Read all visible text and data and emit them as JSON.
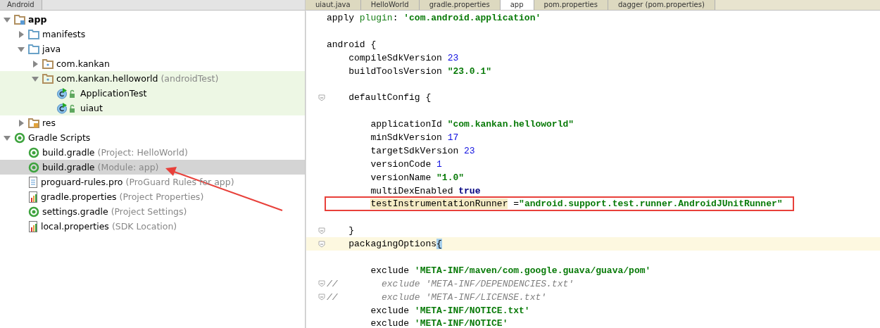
{
  "project_panel": {
    "tab": "Android",
    "tree": [
      {
        "name": "app",
        "kind": "module",
        "bold": true,
        "expanded": true,
        "selected": false,
        "children": [
          {
            "name": "manifests",
            "kind": "folder",
            "expanded": false,
            "selected": false
          },
          {
            "name": "java",
            "kind": "folder",
            "expanded": true,
            "selected": false,
            "children": [
              {
                "name": "com.kankan",
                "kind": "package",
                "expanded": false,
                "selected": false
              },
              {
                "name": "com.kankan.helloworld",
                "detail": "(androidTest)",
                "kind": "package",
                "highlighted": true,
                "expanded": true,
                "selected": false,
                "children": [
                  {
                    "name": "ApplicationTest",
                    "kind": "class",
                    "selected": false
                  },
                  {
                    "name": "uiaut",
                    "kind": "class",
                    "selected": false
                  }
                ]
              }
            ]
          },
          {
            "name": "res",
            "kind": "res",
            "expanded": false,
            "selected": false
          }
        ]
      },
      {
        "name": "Gradle Scripts",
        "kind": "gradle",
        "expanded": true,
        "selected": false,
        "children": [
          {
            "name": "build.gradle",
            "detail": "(Project: HelloWorld)",
            "kind": "gradle",
            "selected": false
          },
          {
            "name": "build.gradle",
            "detail": "(Module: app)",
            "kind": "gradle",
            "selected": true,
            "arrow": true
          },
          {
            "name": "proguard-rules.pro",
            "detail": "(ProGuard Rules for app)",
            "kind": "file",
            "selected": false
          },
          {
            "name": "gradle.properties",
            "detail": "(Project Properties)",
            "kind": "props",
            "selected": false
          },
          {
            "name": "settings.gradle",
            "detail": "(Project Settings)",
            "kind": "gradle",
            "selected": false
          },
          {
            "name": "local.properties",
            "detail": "(SDK Location)",
            "kind": "props",
            "selected": false
          }
        ]
      }
    ]
  },
  "editor_tabs": [
    {
      "label": "uiaut.java",
      "selected": false
    },
    {
      "label": "HelloWorld",
      "selected": false
    },
    {
      "label": "gradle.properties",
      "selected": false
    },
    {
      "label": "app",
      "selected": true
    },
    {
      "label": "pom.properties",
      "selected": false
    },
    {
      "label": "dagger (pom.properties)",
      "selected": false
    }
  ],
  "code": [
    {
      "tokens": [
        {
          "kind": "text",
          "t": "apply "
        },
        {
          "kind": "keyword",
          "t": "plugin"
        },
        {
          "kind": "text",
          "t": ": "
        },
        {
          "kind": "string",
          "t": "'com.android.application'"
        }
      ]
    },
    {
      "blank_before": true,
      "tokens": [
        {
          "kind": "text",
          "t": "android {"
        }
      ]
    },
    {
      "tokens": [
        {
          "kind": "text",
          "t": "    compileSdkVersion "
        },
        {
          "kind": "number",
          "t": "23"
        }
      ]
    },
    {
      "tokens": [
        {
          "kind": "text",
          "t": "    buildToolsVersion "
        },
        {
          "kind": "string",
          "t": "\"23.0.1\""
        }
      ]
    },
    {
      "blank_before": true,
      "fold": true,
      "tokens": [
        {
          "kind": "text",
          "t": "    defaultConfig {"
        }
      ]
    },
    {
      "blank_before": true,
      "tokens": [
        {
          "kind": "text",
          "t": "        applicationId "
        },
        {
          "kind": "string",
          "t": "\"com.kankan.helloworld\""
        }
      ]
    },
    {
      "tokens": [
        {
          "kind": "text",
          "t": "        minSdkVersion "
        },
        {
          "kind": "number",
          "t": "17"
        }
      ]
    },
    {
      "tokens": [
        {
          "kind": "text",
          "t": "        targetSdkVersion "
        },
        {
          "kind": "number",
          "t": "23"
        }
      ]
    },
    {
      "tokens": [
        {
          "kind": "text",
          "t": "        versionCode "
        },
        {
          "kind": "number",
          "t": "1"
        }
      ]
    },
    {
      "tokens": [
        {
          "kind": "text",
          "t": "        versionName "
        },
        {
          "kind": "string",
          "t": "\"1.0\""
        }
      ]
    },
    {
      "tokens": [
        {
          "kind": "text",
          "t": "        multiDexEnabled "
        },
        {
          "kind": "bool",
          "t": "true"
        }
      ]
    },
    {
      "boxed": true,
      "tokens": [
        {
          "kind": "ident",
          "t": "        testInstrumentationRunner"
        },
        {
          "kind": "text",
          "t": " ="
        },
        {
          "kind": "string",
          "t": "\"android.support.test.runner.AndroidJUnitRunner\""
        }
      ]
    },
    {
      "blank_before": true,
      "fold": true,
      "tokens": [
        {
          "kind": "text",
          "t": "    }"
        }
      ]
    },
    {
      "fold": true,
      "current": true,
      "tokens": [
        {
          "kind": "text",
          "t": "    packagingOptions"
        },
        {
          "kind": "brace",
          "t": "{"
        }
      ]
    },
    {
      "blank_before": true,
      "tokens": [
        {
          "kind": "text",
          "t": "        exclude "
        },
        {
          "kind": "string",
          "t": "'META-INF/maven/com.google.guava/guava/pom'"
        }
      ]
    },
    {
      "fold": true,
      "tokens": [
        {
          "kind": "comment",
          "t": "//        exclude 'META-INF/DEPENDENCIES.txt'"
        }
      ]
    },
    {
      "fold": true,
      "tokens": [
        {
          "kind": "comment",
          "t": "//        exclude 'META-INF/LICENSE.txt'"
        }
      ]
    },
    {
      "tokens": [
        {
          "kind": "text",
          "t": "        exclude "
        },
        {
          "kind": "string",
          "t": "'META-INF/NOTICE.txt'"
        }
      ]
    },
    {
      "tokens": [
        {
          "kind": "text",
          "t": "        exclude "
        },
        {
          "kind": "string",
          "t": "'META-INF/NOTICE'"
        }
      ]
    }
  ]
}
